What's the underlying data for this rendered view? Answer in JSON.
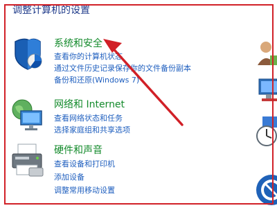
{
  "page": {
    "title": "调整计算机的设置"
  },
  "categories": [
    {
      "title": "系统和安全",
      "icon": "shield-icon",
      "links": [
        "查看你的计算机状态",
        "通过文件历史记录保存你的文件备份副本",
        "备份和还原(Windows 7)"
      ]
    },
    {
      "title": "网络和 Internet",
      "icon": "network-globe-icon",
      "links": [
        "查看网络状态和任务",
        "选择家庭组和共享选项"
      ]
    },
    {
      "title": "硬件和声音",
      "icon": "printer-icon",
      "links": [
        "查看设备和打印机",
        "添加设备",
        "调整常用移动设置"
      ]
    }
  ],
  "colors": {
    "title": "#1e3a8a",
    "category_title": "#138a2b",
    "link": "#1f5fbf",
    "annotation": "#d12027"
  }
}
